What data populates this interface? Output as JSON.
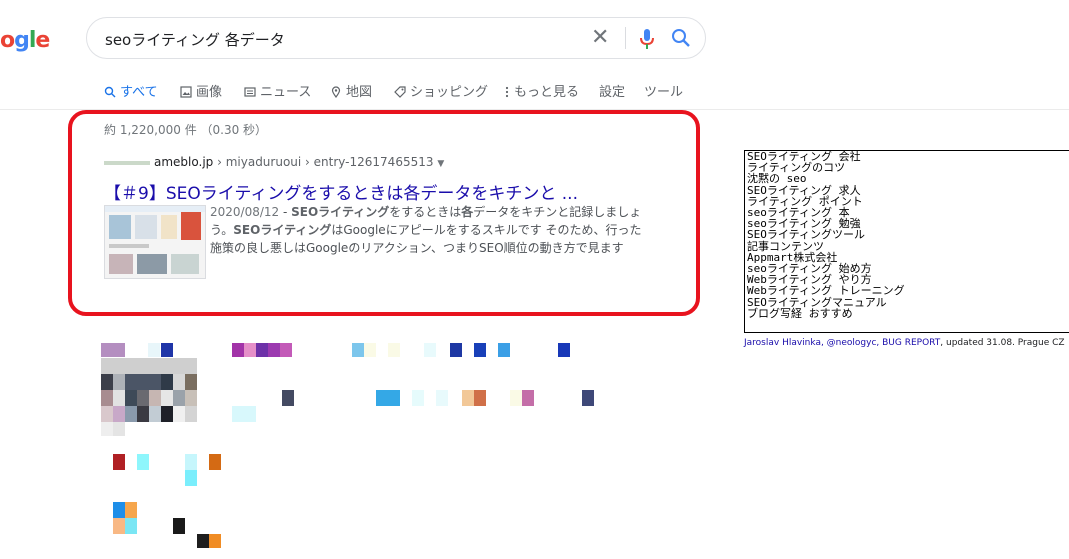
{
  "logo": {
    "text": "ogle"
  },
  "search": {
    "query": "seoライティング 各データ"
  },
  "tabs": [
    {
      "label": "すべて",
      "icon": "search-icon",
      "active": true
    },
    {
      "label": "画像",
      "icon": "image-icon"
    },
    {
      "label": "ニュース",
      "icon": "news-icon"
    },
    {
      "label": "地図",
      "icon": "map-pin-icon"
    },
    {
      "label": "ショッピング",
      "icon": "tag-icon"
    },
    {
      "label": "もっと見る",
      "icon": "more-vert-icon"
    },
    {
      "label": "設定"
    },
    {
      "label": "ツール"
    }
  ],
  "stats": "約 1,220,000 件 （0.30 秒）",
  "result": {
    "domain": "ameblo.jp",
    "path": " › miyaduruoui › entry-12617465513",
    "title": "【＃9】SEOライティングをするときは各データをキチンと ...",
    "date": "2020/08/12",
    "snippet_parts": [
      " - ",
      "SEOライティング",
      "をするときは",
      "各",
      "データをキチンと記録しましょう。",
      "SEOライティング",
      "はGoogleにアピールをするスキルです そのため、行った施策の良し悪しはGoogleのリアクション、つまりSEO順位の動き方で見ます"
    ]
  },
  "suggestions": [
    "SEOライティング 会社",
    "ライティングのコツ",
    "沈黙の seo",
    "SEOライティング 求人",
    "ライティング ポイント",
    "seoライティング 本",
    "seoライティング 勉強",
    "SEOライティングツール",
    "記事コンテンツ",
    "Appmart株式会社",
    "seoライティング 始め方",
    "Webライティング やり方",
    "Webライティング トレーニング",
    "SEOライティングマニュアル",
    "ブログ写経 おすすめ"
  ],
  "credit": {
    "author": "Jaroslav Hlavinka, @neologyc, BUG REPORT",
    "updated": ", updated 31.08. Prague CZ"
  },
  "colors": {
    "highlight_box": "#e8131e",
    "link": "#1a0dab",
    "active_tab": "#1a73e8"
  }
}
